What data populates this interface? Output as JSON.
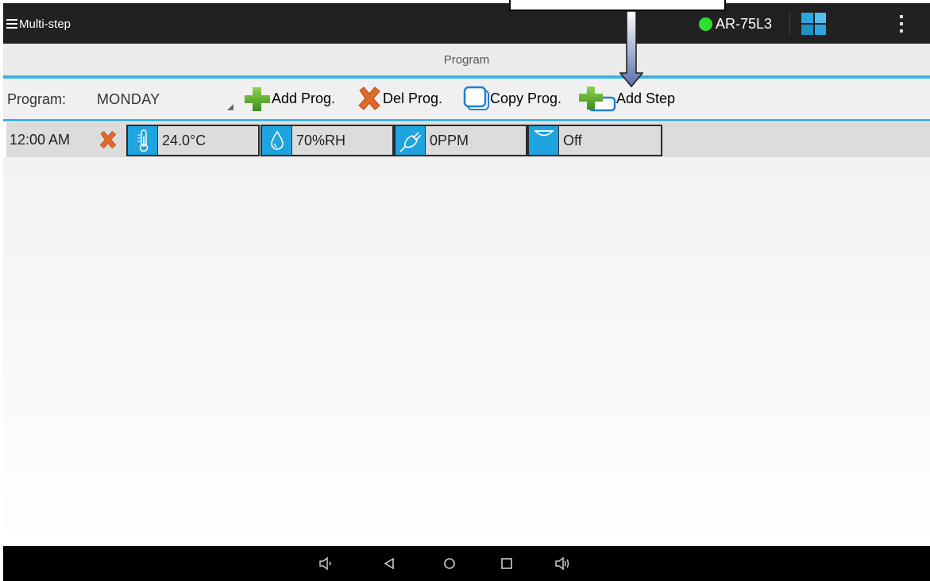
{
  "topbar": {
    "menu_title": "Multi-step",
    "device_name": "AR-75L3",
    "status_color": "#2ee02e"
  },
  "tab": {
    "title": "Program"
  },
  "toolbar": {
    "program_label": "Program:",
    "program_value": "MONDAY",
    "add_prog_label": "Add Prog.",
    "del_prog_label": "Del Prog.",
    "copy_prog_label": "Copy Prog.",
    "add_step_label": "Add Step"
  },
  "steps": [
    {
      "time": "12:00 AM",
      "temperature": "24.0°C",
      "humidity": "70%RH",
      "co2": "0PPM",
      "light": "Off"
    }
  ],
  "colors": {
    "accent": "#33b5e5",
    "chip_icon": "#1ea4de",
    "topbar": "#212121"
  },
  "icons": [
    "hamburger-icon",
    "status-dot-icon",
    "grid-icon",
    "overflow-menu-icon",
    "plus-icon",
    "delete-x-icon",
    "copy-icon",
    "add-step-icon",
    "thermometer-icon",
    "droplet-icon",
    "plug-icon",
    "lamp-icon",
    "volume-down-icon",
    "back-icon",
    "home-icon",
    "recents-icon",
    "volume-up-icon"
  ]
}
